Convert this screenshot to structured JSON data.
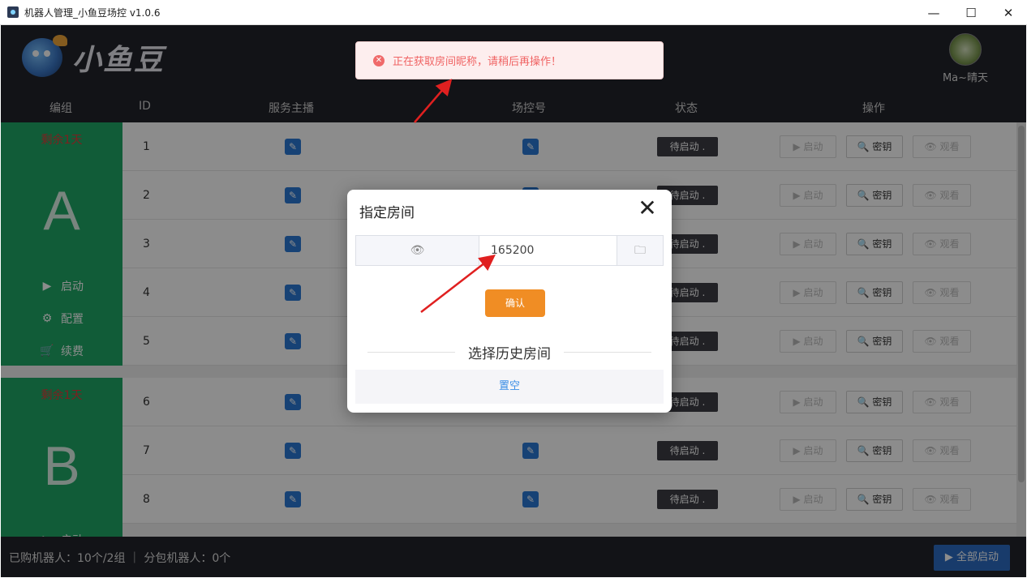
{
  "window": {
    "title": "机器人管理_小鱼豆场控 v1.0.6",
    "minimize": "—",
    "maximize": "☐",
    "close": "✕"
  },
  "header": {
    "logo_text": "小鱼豆",
    "username": "Ma~晴天"
  },
  "table": {
    "headers": [
      "编组",
      "ID",
      "服务主播",
      "场控号",
      "状态",
      "操作"
    ]
  },
  "groups": [
    {
      "remain": "剩余1天",
      "letter": "A",
      "menu": [
        {
          "icon": "▶",
          "label": "启动"
        },
        {
          "icon": "⚙",
          "label": "配置"
        },
        {
          "icon": "🛒",
          "label": "续费"
        }
      ],
      "rows": [
        {
          "id": "1",
          "status": "待启动 .",
          "start": "▶ 启动",
          "key": "🔍 密钥",
          "watch": "👁 观看"
        },
        {
          "id": "2",
          "status": "待启动 .",
          "start": "▶ 启动",
          "key": "🔍 密钥",
          "watch": "👁 观看"
        },
        {
          "id": "3",
          "status": "待启动 .",
          "start": "▶ 启动",
          "key": "🔍 密钥",
          "watch": "👁 观看"
        },
        {
          "id": "4",
          "status": "待启动 .",
          "start": "▶ 启动",
          "key": "🔍 密钥",
          "watch": "👁 观看"
        },
        {
          "id": "5",
          "status": "待启动 .",
          "start": "▶ 启动",
          "key": "🔍 密钥",
          "watch": "👁 观看"
        }
      ]
    },
    {
      "remain": "剩余1天",
      "letter": "B",
      "menu": [
        {
          "icon": "▶",
          "label": "启动"
        }
      ],
      "rows": [
        {
          "id": "6",
          "status": "待启动 .",
          "start": "▶ 启动",
          "key": "🔍 密钥",
          "watch": "👁 观看"
        },
        {
          "id": "7",
          "status": "待启动 .",
          "start": "▶ 启动",
          "key": "🔍 密钥",
          "watch": "👁 观看"
        },
        {
          "id": "8",
          "status": "待启动 .",
          "start": "▶ 启动",
          "key": "🔍 密钥",
          "watch": "👁 观看"
        }
      ]
    }
  ],
  "footer": {
    "stats": "已购机器人：10个/2组 ｜ 分包机器人：0个",
    "start_all": "▶ 全部启动"
  },
  "toast": {
    "icon": "✕",
    "message": "正在获取房间昵称，请稍后再操作！"
  },
  "dialog": {
    "title": "指定房间",
    "close": "✕",
    "eye_icon": "👁",
    "room_value": "165200",
    "folder_icon": "🗀",
    "confirm": "确认",
    "history": "选择历史房间",
    "clear": "置空"
  },
  "colors": {
    "group_green": "#1fa866",
    "dark_bar": "#22232b",
    "edit_blue": "#2a79d6",
    "toast_red": "#f06363",
    "confirm_orange": "#f08d24",
    "arrow_red": "#e02020"
  }
}
